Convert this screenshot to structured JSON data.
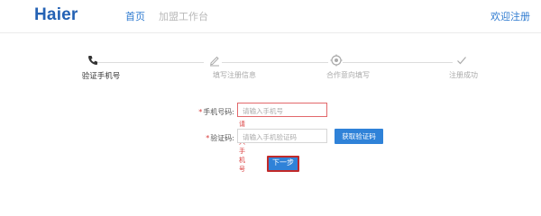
{
  "header": {
    "logo": "Haier",
    "nav": [
      "首页",
      "加盟工作台"
    ],
    "welcome": "欢迎注册"
  },
  "steps": [
    {
      "label": "验证手机号",
      "icon": "phone-icon",
      "active": true
    },
    {
      "label": "填写注册信息",
      "icon": "pencil-icon",
      "active": false
    },
    {
      "label": "合作意向填写",
      "icon": "target-icon",
      "active": false
    },
    {
      "label": "注册成功",
      "icon": "checkmark-icon",
      "active": false
    }
  ],
  "form": {
    "phone_label": "手机号码:",
    "phone_placeholder": "请输入手机号",
    "phone_error": "请输入手机号",
    "code_label": "验证码:",
    "code_placeholder": "请输入手机验证码",
    "get_code_button": "获取验证码",
    "next_button": "下一步",
    "required_mark": "*"
  },
  "colors": {
    "brand": "#2462b4",
    "link": "#2f7bd0",
    "button": "#2f82d8",
    "error": "#d93a3a"
  }
}
